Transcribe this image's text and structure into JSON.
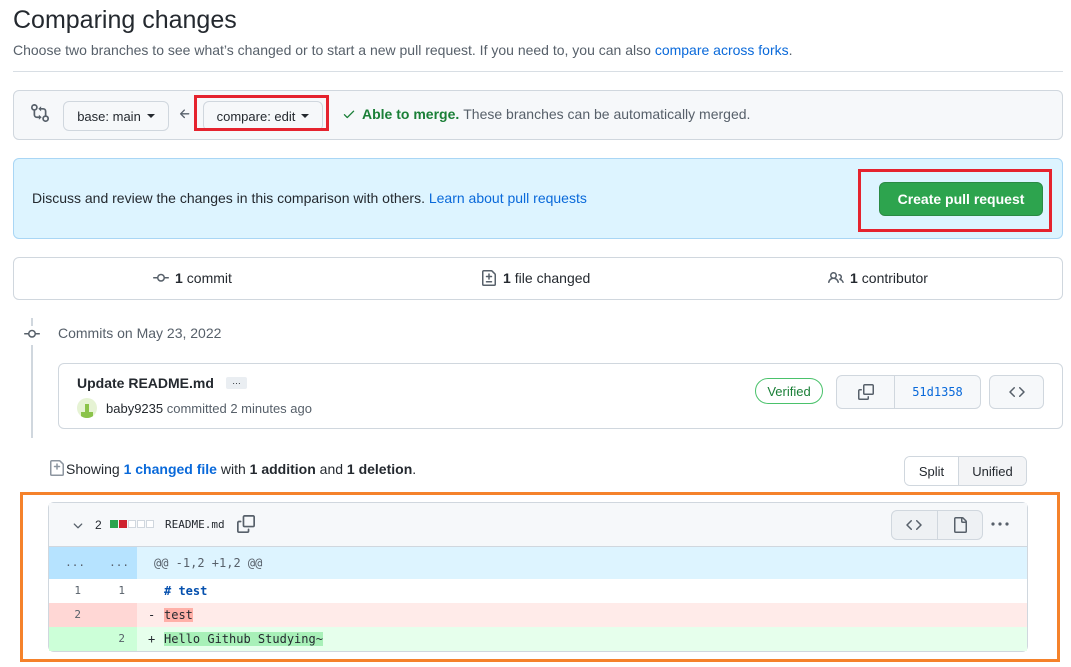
{
  "header": {
    "title": "Comparing changes",
    "subtitle_prefix": "Choose two branches to see what’s changed or to start a new pull request. If you need to, you can also ",
    "subtitle_link": "compare across forks",
    "subtitle_suffix": "."
  },
  "range": {
    "base_label": "base: main",
    "compare_label": "compare: edit",
    "merge_ok": "Able to merge.",
    "merge_text": "These branches can be automatically merged."
  },
  "banner": {
    "text": "Discuss and review the changes in this comparison with others. ",
    "link": "Learn about pull requests",
    "button": "Create pull request"
  },
  "summary": {
    "commits_count": "1",
    "commits_label": "commit",
    "files_count": "1",
    "files_label": "file changed",
    "contributors_count": "1",
    "contributors_label": "contributor"
  },
  "commits": {
    "date_heading": "Commits on May 23, 2022",
    "items": [
      {
        "title": "Update README.md",
        "ellipsis": "…",
        "author": "baby9235",
        "meta": "committed 2 minutes ago",
        "badge": "Verified",
        "sha": "51d1358"
      }
    ]
  },
  "diff": {
    "showing_prefix": "Showing ",
    "showing_link": "1 changed file",
    "showing_mid1": " with ",
    "additions": "1 addition",
    "showing_mid2": " and ",
    "deletions": "1 deletion",
    "showing_suffix": ".",
    "view_split": "Split",
    "view_unified": "Unified",
    "file": {
      "changes": "2",
      "name": "README.md",
      "hunk_expand_left": "...",
      "hunk_expand_right": "...",
      "hunk": "@@ -1,2 +1,2 @@",
      "lines": [
        {
          "old": "1",
          "new": "1",
          "sign": " ",
          "text": "# test"
        },
        {
          "old": "2",
          "new": "",
          "sign": "-",
          "text": "test"
        },
        {
          "old": "",
          "new": "2",
          "sign": "+",
          "text": "Hello Github Studying~"
        }
      ]
    }
  },
  "colors": {
    "accent": "#0969da",
    "success": "#2da44e",
    "highlight_red": "#e5232e",
    "highlight_orange": "#f5822b"
  }
}
